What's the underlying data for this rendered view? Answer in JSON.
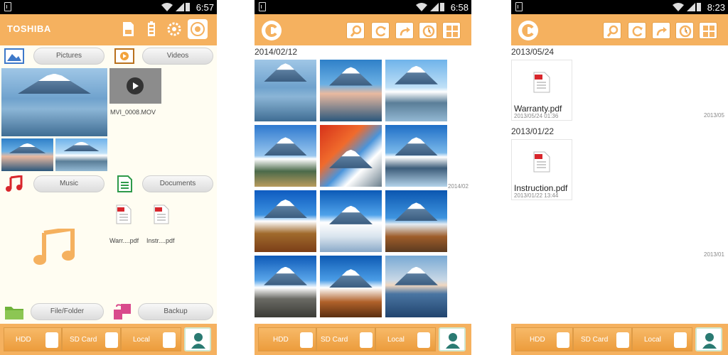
{
  "status": {
    "time1": "6:57",
    "time2": "6:58",
    "time3": "8:23"
  },
  "screen1": {
    "brand": "TOSHIBA",
    "pictures_label": "Pictures",
    "videos_label": "Videos",
    "video_name": "MVI_0008.MOV",
    "music_label": "Music",
    "documents_label": "Documents",
    "doc1": "Warr....pdf",
    "doc2": "Instr....pdf",
    "filefolder_label": "File/Folder",
    "backup_label": "Backup"
  },
  "screen2": {
    "date": "2014/02/12",
    "side_date": "2014/02"
  },
  "screen3": {
    "group1_date": "2013/05/24",
    "file1_name": "Warranty.pdf",
    "file1_date": "2013/05/24 01:36",
    "side1": "2013/05",
    "group2_date": "2013/01/22",
    "file2_name": "Instruction.pdf",
    "file2_date": "2013/01/22 13:44",
    "side2": "2013/01"
  },
  "bottombar": {
    "hdd": "HDD",
    "sdcard": "SD Card",
    "local": "Local"
  },
  "colors": {
    "accent": "#f5b15f",
    "panel": "#fffdf2"
  }
}
